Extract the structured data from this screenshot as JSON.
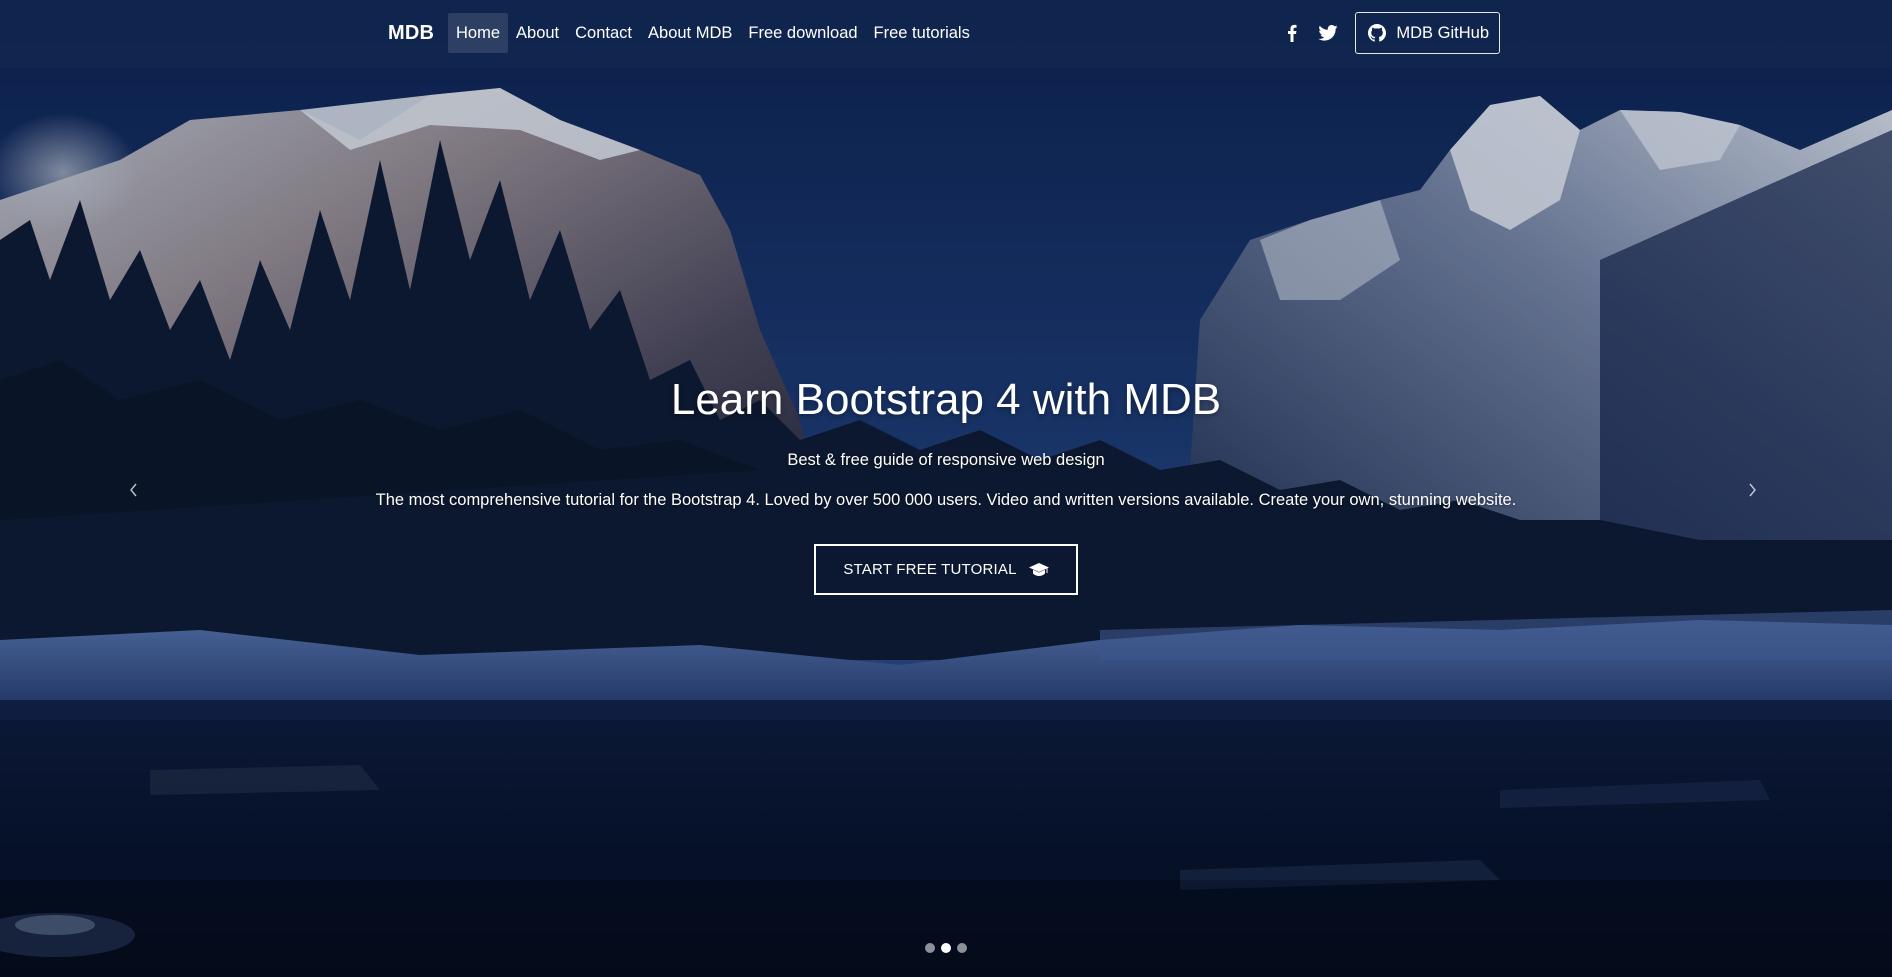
{
  "navbar": {
    "brand": "MDB",
    "links": [
      {
        "label": "Home",
        "active": true
      },
      {
        "label": "About",
        "active": false
      },
      {
        "label": "Contact",
        "active": false
      },
      {
        "label": "About MDB",
        "active": false
      },
      {
        "label": "Free download",
        "active": false
      },
      {
        "label": "Free tutorials",
        "active": false
      }
    ],
    "social": [
      {
        "icon": "facebook-icon"
      },
      {
        "icon": "twitter-icon"
      }
    ],
    "github_button": {
      "label": "MDB GitHub",
      "icon": "github-icon"
    }
  },
  "hero": {
    "title": "Learn Bootstrap 4 with MDB",
    "subtitle": "Best & free guide of responsive web design",
    "description": "The most comprehensive tutorial for the Bootstrap 4. Loved by over 500 000 users. Video and written versions available. Create your own, stunning website.",
    "cta": {
      "label": "START FREE TUTORIAL",
      "icon": "graduation-cap-icon"
    }
  },
  "carousel": {
    "prev_icon": "chevron-left-icon",
    "next_icon": "chevron-right-icon",
    "slides": 3,
    "active_slide": 2
  },
  "colors": {
    "sky_top": "#0d2350",
    "sky_mid": "#1c3a72",
    "water": "#060e1f",
    "navbar_bg": "rgba(20,42,80,0.55)",
    "text": "#ffffff"
  }
}
